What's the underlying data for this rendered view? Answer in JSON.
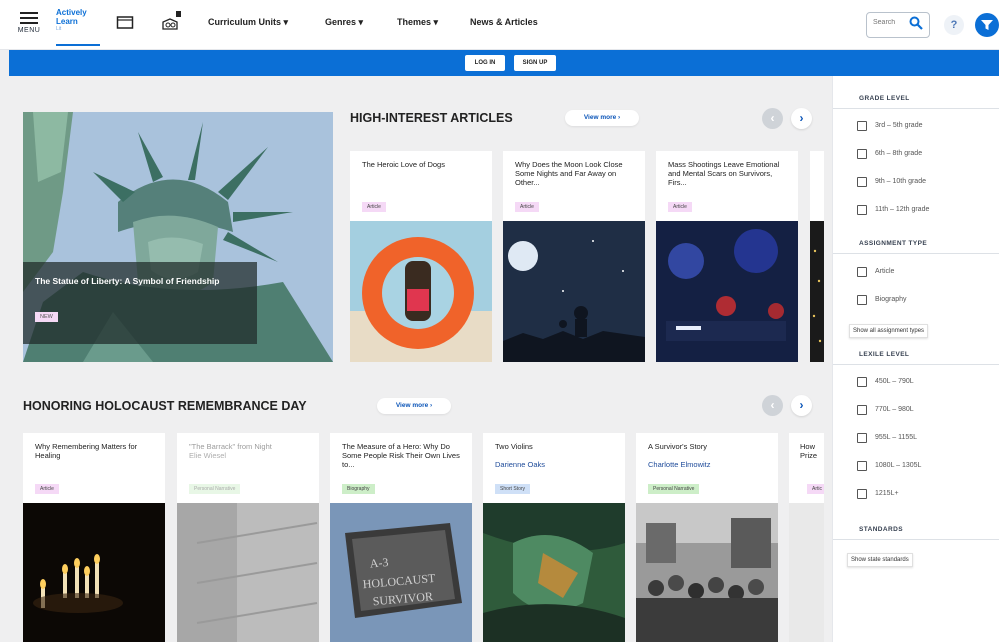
{
  "nav": {
    "menu_label": "MENU",
    "logo_line1": "Actively",
    "logo_line2": "Learn",
    "logo_line3": "Lit",
    "links": [
      "Curriculum Units ▾",
      "Genres ▾",
      "Themes ▾",
      "News & Articles"
    ],
    "search_placeholder": "Search",
    "help_label": "?"
  },
  "auth": {
    "login_label": "LOG IN",
    "signup_label": "SIGN UP"
  },
  "hero": {
    "title": "The Statue of Liberty: A Symbol of Friendship",
    "tag": "NEW"
  },
  "section1": {
    "title": "HIGH-INTEREST ARTICLES",
    "view_more": "View more ›",
    "cards": [
      {
        "title": "The Heroic Love of Dogs",
        "tag": "Article"
      },
      {
        "title": "Why Does the Moon Look Close Some Nights and Far Away on Other...",
        "tag": "Article"
      },
      {
        "title": "Mass Shootings Leave Emotional and Mental Scars on Survivors, Firs...",
        "tag": "Article"
      }
    ]
  },
  "section2": {
    "title": "HONORING HOLOCAUST REMEMBRANCE DAY",
    "view_more": "View more ›",
    "cards": [
      {
        "title": "Why Remembering Matters for Healing",
        "author": "",
        "tag": "Article"
      },
      {
        "title": "\"The Barrack\" from Night",
        "author": "Elie Wiesel",
        "tag": "Personal Narrative"
      },
      {
        "title": "The Measure of a Hero: Why Do Some People Risk Their Own Lives to...",
        "author": "",
        "tag": "Biography"
      },
      {
        "title": "Two Violins",
        "author": "Darienne Oaks",
        "tag": "Short Story"
      },
      {
        "title": "A Survivor's Story",
        "author": "Charlotte Elmowitz",
        "tag": "Personal Narrative"
      },
      {
        "title": "How Prize",
        "author": "",
        "tag": "Artic"
      }
    ]
  },
  "sidebar": {
    "grade_level": "GRADE LEVEL",
    "grades": [
      "3rd – 5th grade",
      "6th – 8th grade",
      "9th – 10th grade",
      "11th – 12th grade"
    ],
    "assignment_type": "ASSIGNMENT TYPE",
    "types": [
      "Article",
      "Biography"
    ],
    "show_all_types": "Show all assignment types",
    "lexile_level": "LEXILE LEVEL",
    "lexiles": [
      "450L – 790L",
      "770L – 980L",
      "955L – 1155L",
      "1080L – 1305L",
      "1215L+"
    ],
    "standards": "STANDARDS",
    "show_state_standards": "Show state standards"
  },
  "colors": {
    "brand_blue": "#0b6fd6",
    "article_tag": "#f5d9f6",
    "narrative_tag": "#cdeec8",
    "short_story_tag": "#cfe0f7"
  },
  "icons": [
    "menu-icon",
    "folder-icon",
    "classroom-icon",
    "search-icon",
    "help-icon",
    "filter-icon",
    "chevron-left-icon",
    "chevron-right-icon"
  ]
}
